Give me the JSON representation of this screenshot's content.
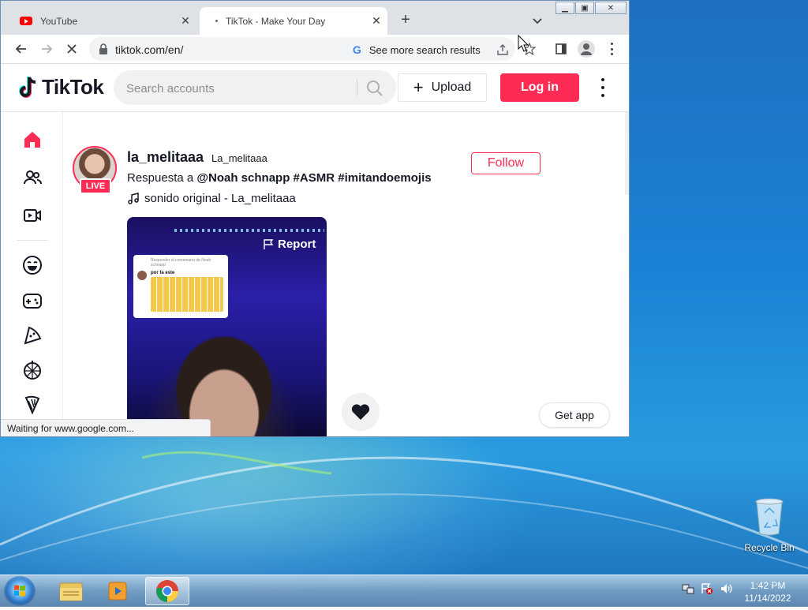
{
  "browser": {
    "tabs": [
      {
        "label": "YouTube",
        "active": false
      },
      {
        "label": "TikTok - Make Your Day",
        "active": true
      }
    ],
    "new_tab_icon": "plus-icon",
    "url": "tiktok.com/en/",
    "search_chip": "See more search results",
    "status": "Waiting for www.google.com..."
  },
  "tiktok": {
    "brand": "TikTok",
    "search_placeholder": "Search accounts",
    "upload_label": "Upload",
    "login_label": "Log in",
    "accent": "#fe2c55"
  },
  "sidenav": {
    "items": [
      "home-icon",
      "following-icon",
      "live-icon",
      "comedy-icon",
      "gaming-icon",
      "food-icon",
      "dance-icon",
      "beauty-icon"
    ]
  },
  "post": {
    "username": "la_melitaaa",
    "nickname": "La_melitaaa",
    "live_badge": "LIVE",
    "caption_prefix": "Respuesta a ",
    "caption_mention": "@Noah schnapp",
    "caption_tags": "#ASMR #imitandoemojis",
    "music": "sonido original - La_melitaaa",
    "follow_label": "Follow",
    "report_label": "Report",
    "bubble_header": "Responder al comentario de Noah schnapp",
    "bubble_text": "por fa este"
  },
  "get_app_label": "Get app",
  "desktop": {
    "recycle_bin": "Recycle Bin",
    "clock_time": "1:42 PM",
    "clock_date": "11/14/2022"
  }
}
